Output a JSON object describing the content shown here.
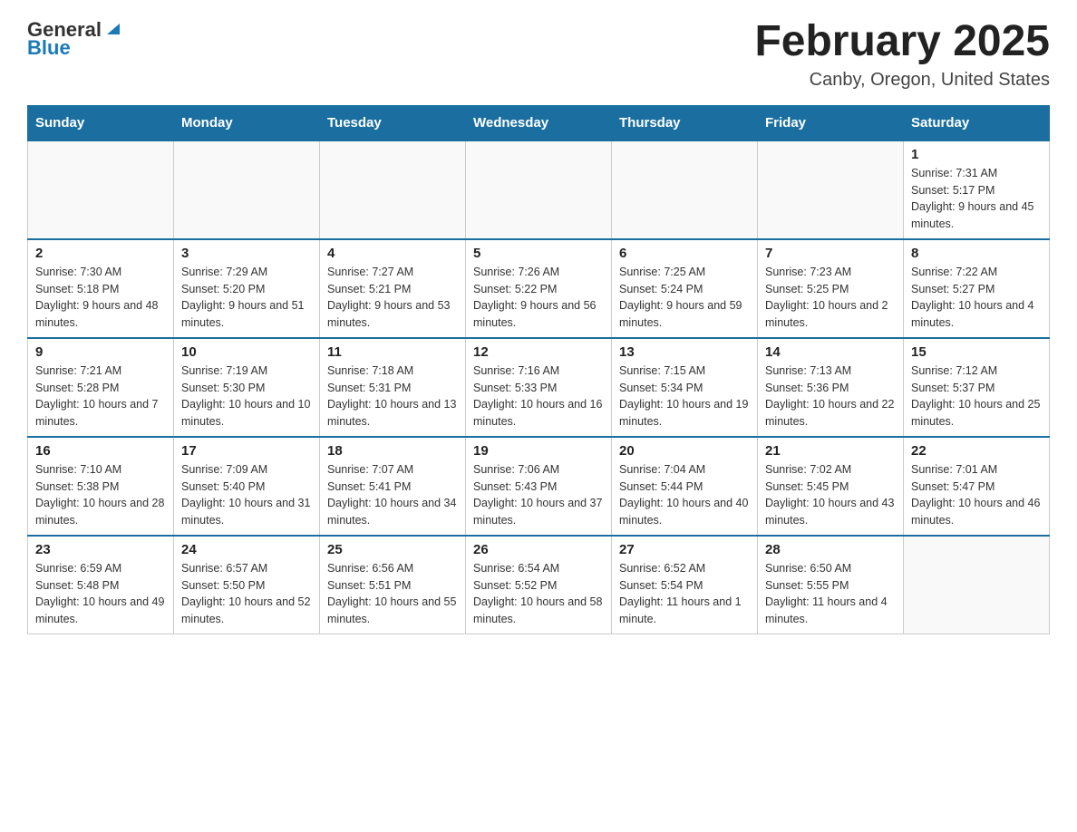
{
  "header": {
    "logo_general": "General",
    "logo_blue": "Blue",
    "title": "February 2025",
    "subtitle": "Canby, Oregon, United States"
  },
  "days_of_week": [
    "Sunday",
    "Monday",
    "Tuesday",
    "Wednesday",
    "Thursday",
    "Friday",
    "Saturday"
  ],
  "weeks": [
    [
      {
        "day": "",
        "info": ""
      },
      {
        "day": "",
        "info": ""
      },
      {
        "day": "",
        "info": ""
      },
      {
        "day": "",
        "info": ""
      },
      {
        "day": "",
        "info": ""
      },
      {
        "day": "",
        "info": ""
      },
      {
        "day": "1",
        "info": "Sunrise: 7:31 AM\nSunset: 5:17 PM\nDaylight: 9 hours and 45 minutes."
      }
    ],
    [
      {
        "day": "2",
        "info": "Sunrise: 7:30 AM\nSunset: 5:18 PM\nDaylight: 9 hours and 48 minutes."
      },
      {
        "day": "3",
        "info": "Sunrise: 7:29 AM\nSunset: 5:20 PM\nDaylight: 9 hours and 51 minutes."
      },
      {
        "day": "4",
        "info": "Sunrise: 7:27 AM\nSunset: 5:21 PM\nDaylight: 9 hours and 53 minutes."
      },
      {
        "day": "5",
        "info": "Sunrise: 7:26 AM\nSunset: 5:22 PM\nDaylight: 9 hours and 56 minutes."
      },
      {
        "day": "6",
        "info": "Sunrise: 7:25 AM\nSunset: 5:24 PM\nDaylight: 9 hours and 59 minutes."
      },
      {
        "day": "7",
        "info": "Sunrise: 7:23 AM\nSunset: 5:25 PM\nDaylight: 10 hours and 2 minutes."
      },
      {
        "day": "8",
        "info": "Sunrise: 7:22 AM\nSunset: 5:27 PM\nDaylight: 10 hours and 4 minutes."
      }
    ],
    [
      {
        "day": "9",
        "info": "Sunrise: 7:21 AM\nSunset: 5:28 PM\nDaylight: 10 hours and 7 minutes."
      },
      {
        "day": "10",
        "info": "Sunrise: 7:19 AM\nSunset: 5:30 PM\nDaylight: 10 hours and 10 minutes."
      },
      {
        "day": "11",
        "info": "Sunrise: 7:18 AM\nSunset: 5:31 PM\nDaylight: 10 hours and 13 minutes."
      },
      {
        "day": "12",
        "info": "Sunrise: 7:16 AM\nSunset: 5:33 PM\nDaylight: 10 hours and 16 minutes."
      },
      {
        "day": "13",
        "info": "Sunrise: 7:15 AM\nSunset: 5:34 PM\nDaylight: 10 hours and 19 minutes."
      },
      {
        "day": "14",
        "info": "Sunrise: 7:13 AM\nSunset: 5:36 PM\nDaylight: 10 hours and 22 minutes."
      },
      {
        "day": "15",
        "info": "Sunrise: 7:12 AM\nSunset: 5:37 PM\nDaylight: 10 hours and 25 minutes."
      }
    ],
    [
      {
        "day": "16",
        "info": "Sunrise: 7:10 AM\nSunset: 5:38 PM\nDaylight: 10 hours and 28 minutes."
      },
      {
        "day": "17",
        "info": "Sunrise: 7:09 AM\nSunset: 5:40 PM\nDaylight: 10 hours and 31 minutes."
      },
      {
        "day": "18",
        "info": "Sunrise: 7:07 AM\nSunset: 5:41 PM\nDaylight: 10 hours and 34 minutes."
      },
      {
        "day": "19",
        "info": "Sunrise: 7:06 AM\nSunset: 5:43 PM\nDaylight: 10 hours and 37 minutes."
      },
      {
        "day": "20",
        "info": "Sunrise: 7:04 AM\nSunset: 5:44 PM\nDaylight: 10 hours and 40 minutes."
      },
      {
        "day": "21",
        "info": "Sunrise: 7:02 AM\nSunset: 5:45 PM\nDaylight: 10 hours and 43 minutes."
      },
      {
        "day": "22",
        "info": "Sunrise: 7:01 AM\nSunset: 5:47 PM\nDaylight: 10 hours and 46 minutes."
      }
    ],
    [
      {
        "day": "23",
        "info": "Sunrise: 6:59 AM\nSunset: 5:48 PM\nDaylight: 10 hours and 49 minutes."
      },
      {
        "day": "24",
        "info": "Sunrise: 6:57 AM\nSunset: 5:50 PM\nDaylight: 10 hours and 52 minutes."
      },
      {
        "day": "25",
        "info": "Sunrise: 6:56 AM\nSunset: 5:51 PM\nDaylight: 10 hours and 55 minutes."
      },
      {
        "day": "26",
        "info": "Sunrise: 6:54 AM\nSunset: 5:52 PM\nDaylight: 10 hours and 58 minutes."
      },
      {
        "day": "27",
        "info": "Sunrise: 6:52 AM\nSunset: 5:54 PM\nDaylight: 11 hours and 1 minute."
      },
      {
        "day": "28",
        "info": "Sunrise: 6:50 AM\nSunset: 5:55 PM\nDaylight: 11 hours and 4 minutes."
      },
      {
        "day": "",
        "info": ""
      }
    ]
  ]
}
